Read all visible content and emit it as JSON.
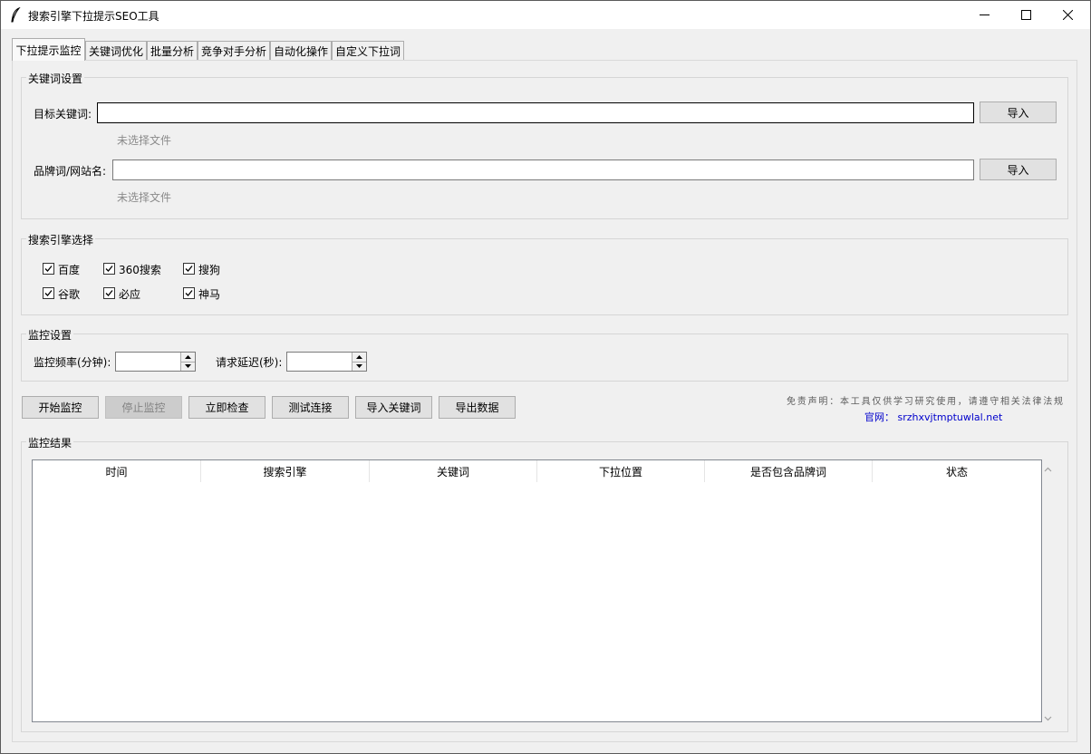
{
  "window": {
    "title": "搜索引擎下拉提示SEO工具",
    "icon": "feather-icon"
  },
  "tabs": [
    {
      "label": "下拉提示监控",
      "active": true
    },
    {
      "label": "关键词优化"
    },
    {
      "label": "批量分析"
    },
    {
      "label": "竞争对手分析"
    },
    {
      "label": "自动化操作"
    },
    {
      "label": "自定义下拉词"
    }
  ],
  "keyword_settings": {
    "title": "关键词设置",
    "target_keyword": {
      "label": "目标关键词:",
      "value": "",
      "import_label": "导入",
      "file_status": "未选择文件"
    },
    "brand_word": {
      "label": "品牌词/网站名:",
      "value": "",
      "import_label": "导入",
      "file_status": "未选择文件"
    }
  },
  "engine_selection": {
    "title": "搜索引擎选择",
    "engines": [
      {
        "label": "百度",
        "checked": true
      },
      {
        "label": "360搜索",
        "checked": true
      },
      {
        "label": "搜狗",
        "checked": true
      },
      {
        "label": "谷歌",
        "checked": true
      },
      {
        "label": "必应",
        "checked": true
      },
      {
        "label": "神马",
        "checked": true
      }
    ]
  },
  "monitor_settings": {
    "title": "监控设置",
    "frequency_label": "监控频率(分钟):",
    "frequency_value": "",
    "delay_label": "请求延迟(秒):",
    "delay_value": ""
  },
  "actions": {
    "start": "开始监控",
    "stop": "停止监控",
    "check_now": "立即检查",
    "test_connection": "测试连接",
    "import_keywords": "导入关键词",
    "export_data": "导出数据"
  },
  "disclaimer": {
    "text": "免责声明：本工具仅供学习研究使用，请遵守相关法律法规",
    "site_label": "官网：",
    "site_url": "srzhxvjtmptuwlal.net"
  },
  "results": {
    "title": "监控结果",
    "columns": [
      "时间",
      "搜索引擎",
      "关键词",
      "下拉位置",
      "是否包含品牌词",
      "状态"
    ],
    "rows": []
  },
  "colors": {
    "link": "#0000cc",
    "window_bg": "#f0f0f0"
  }
}
